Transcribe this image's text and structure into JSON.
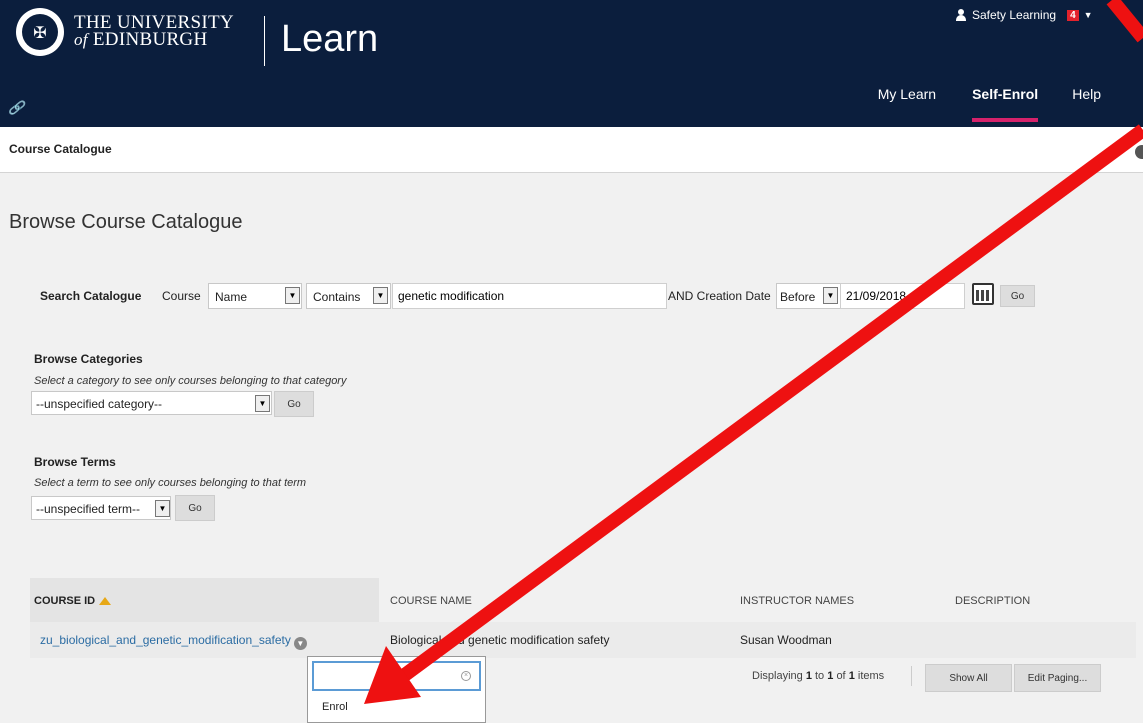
{
  "header": {
    "university_line1": "THE UNIVERSITY",
    "university_of": "of",
    "university_line2": "EDINBURGH",
    "app_name": "Learn",
    "user_name": "Safety Learning",
    "notification_count": "4",
    "nav": [
      {
        "label": "My Learn",
        "active": false
      },
      {
        "label": "Self-Enrol",
        "active": true
      },
      {
        "label": "Help",
        "active": false
      }
    ]
  },
  "breadcrumb": {
    "title": "Course Catalogue"
  },
  "page": {
    "heading": "Browse Course Catalogue"
  },
  "search": {
    "label": "Search Catalogue",
    "field_label": "Course",
    "field_value": "Name",
    "operator_value": "Contains",
    "query_value": "genetic modification",
    "date_label": "AND Creation Date",
    "date_operator_value": "Before",
    "date_value": "21/09/2018",
    "go_label": "Go"
  },
  "categories": {
    "title": "Browse Categories",
    "description": "Select a category to see only courses belonging to that category",
    "selected": "--unspecified category--",
    "go_label": "Go"
  },
  "terms": {
    "title": "Browse Terms",
    "description": "Select a term to see only courses belonging to that term",
    "selected": "--unspecified term--",
    "go_label": "Go"
  },
  "table": {
    "columns": [
      "COURSE ID",
      "COURSE NAME",
      "INSTRUCTOR NAMES",
      "DESCRIPTION"
    ],
    "rows": [
      {
        "course_id": "zu_biological_and_genetic_modification_safety",
        "course_name": "Biological and genetic modification safety",
        "instructor": "Susan Woodman",
        "description": ""
      }
    ]
  },
  "context_menu": {
    "search_value": "",
    "items": [
      "Enrol"
    ]
  },
  "paging": {
    "prefix": "Displaying",
    "from": "1",
    "to_word": "to",
    "to": "1",
    "of_word": "of",
    "total": "1",
    "suffix": "items",
    "show_all_label": "Show All",
    "edit_paging_label": "Edit Paging..."
  },
  "colors": {
    "header_bg": "#0b1e3d",
    "active_tab_underline": "#d6226b",
    "link": "#2b6ca3",
    "annotation_arrow": "#ee1111"
  }
}
